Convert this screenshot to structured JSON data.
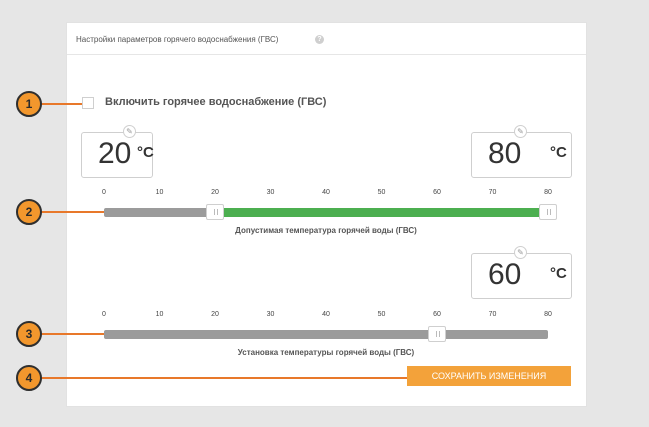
{
  "panel": {
    "title": "Настройки параметров горячего водоснабжения (ГВС)",
    "help_icon": "?"
  },
  "hot_water": {
    "enable_label": "Включить горячее водоснабжение (ГВС)",
    "enabled": false
  },
  "allowed_range": {
    "min_value": "20",
    "max_value": "80",
    "unit": "°C",
    "caption": "Допустимая температура горячей воды (ГВС)",
    "low": 20,
    "high": 80
  },
  "setpoint": {
    "value": "60",
    "unit": "°C",
    "caption": "Установка температуры горячей воды (ГВС)",
    "level": 60
  },
  "scale": {
    "min": 0,
    "max": 80,
    "ticks": [
      "0",
      "10",
      "20",
      "30",
      "40",
      "50",
      "60",
      "70",
      "80"
    ]
  },
  "actions": {
    "save_label": "СОХРАНИТЬ ИЗМЕНЕНИЯ"
  },
  "callouts": [
    "1",
    "2",
    "3",
    "4"
  ],
  "colors": {
    "accent_orange": "#f3a23a",
    "range_green": "#4caf50",
    "track_gray": "#9b9b9b"
  },
  "icons": {
    "edit": "wrench-icon",
    "help": "question-icon"
  }
}
